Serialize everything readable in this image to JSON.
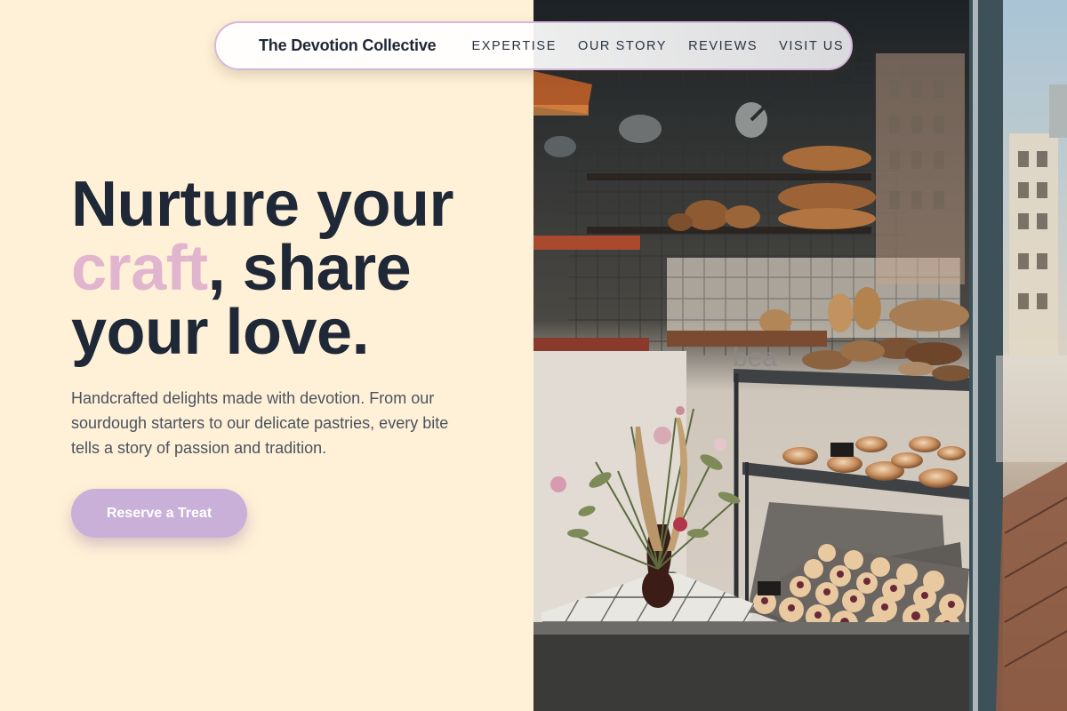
{
  "header": {
    "brand": "The Devotion Collective",
    "nav": [
      {
        "label": "EXPERTISE"
      },
      {
        "label": "OUR STORY"
      },
      {
        "label": "REVIEWS"
      },
      {
        "label": "VISIT US"
      }
    ]
  },
  "hero": {
    "title_line1": "Nurture your",
    "title_accent": "craft",
    "title_line2_rest": ", share",
    "title_line3": "your love.",
    "description": "Handcrafted delights made with devotion. From our sourdough starters to our delicate pastries, every bite tells a story of passion and tradition.",
    "cta_label": "Reserve a Treat"
  },
  "image": {
    "subject": "bakery-window-photo",
    "glass_text": "bea"
  },
  "colors": {
    "background": "#fff1d7",
    "heading": "#1f2836",
    "accent": "#e2b5cf",
    "button": "#c9b0d8",
    "nav_border": "#d4b8dc"
  }
}
